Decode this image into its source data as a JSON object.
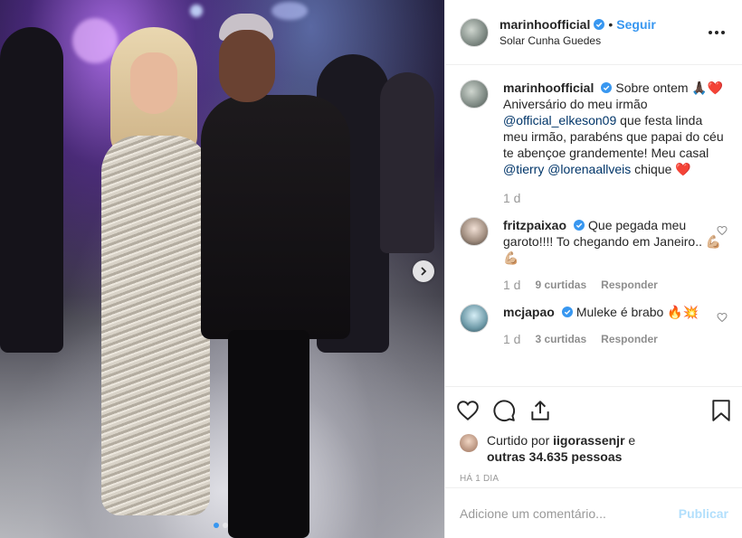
{
  "post": {
    "author": {
      "username": "marinhoofficial",
      "verified": true,
      "location": "Solar Cunha Guedes",
      "follow_label": "Seguir",
      "separator": "•"
    },
    "caption": {
      "username": "marinhoofficial",
      "text_1": "Sobre ontem 🙏🏿❤️ Aniversário do meu irmão ",
      "mention_1": "@official_elkeson09",
      "text_2": " que festa linda meu irmão, parabéns que papai do céu te abençoe grandemente! Meu casal ",
      "mention_2": "@tierry",
      "mention_3": "@lorenaallveis",
      "text_3": " chique ❤️",
      "time": "1 d"
    },
    "comments": [
      {
        "username": "fritzpaixao",
        "verified": true,
        "text": "Que pegada meu garoto!!!! To chegando em Janeiro.. 💪🏼💪🏼",
        "time": "1 d",
        "likes": "9 curtidas",
        "reply_label": "Responder"
      },
      {
        "username": "mcjapao",
        "verified": true,
        "text": "Muleke é brabo 🔥💥",
        "time": "1 d",
        "likes": "3 curtidas",
        "reply_label": "Responder"
      }
    ],
    "likes": {
      "prefix": "Curtido por ",
      "first_user": "iigorassenjr",
      "middle": " e ",
      "others": "outras 34.635 pessoas"
    },
    "timestamp": "HÁ 1 DIA",
    "add_comment": {
      "placeholder": "Adicione um comentário...",
      "publish_label": "Publicar"
    },
    "carousel": {
      "total": 2,
      "active_index": 0
    }
  },
  "icons": {
    "more": "more-options-icon",
    "verified": "verified-badge-icon",
    "heart": "heart-icon",
    "comment": "comment-icon",
    "share": "share-icon",
    "bookmark": "bookmark-icon",
    "next": "chevron-right-icon"
  },
  "colors": {
    "accent": "#3897f0",
    "mention": "#003569",
    "muted": "#8e8e8e",
    "publish_disabled": "#b2dffc"
  }
}
